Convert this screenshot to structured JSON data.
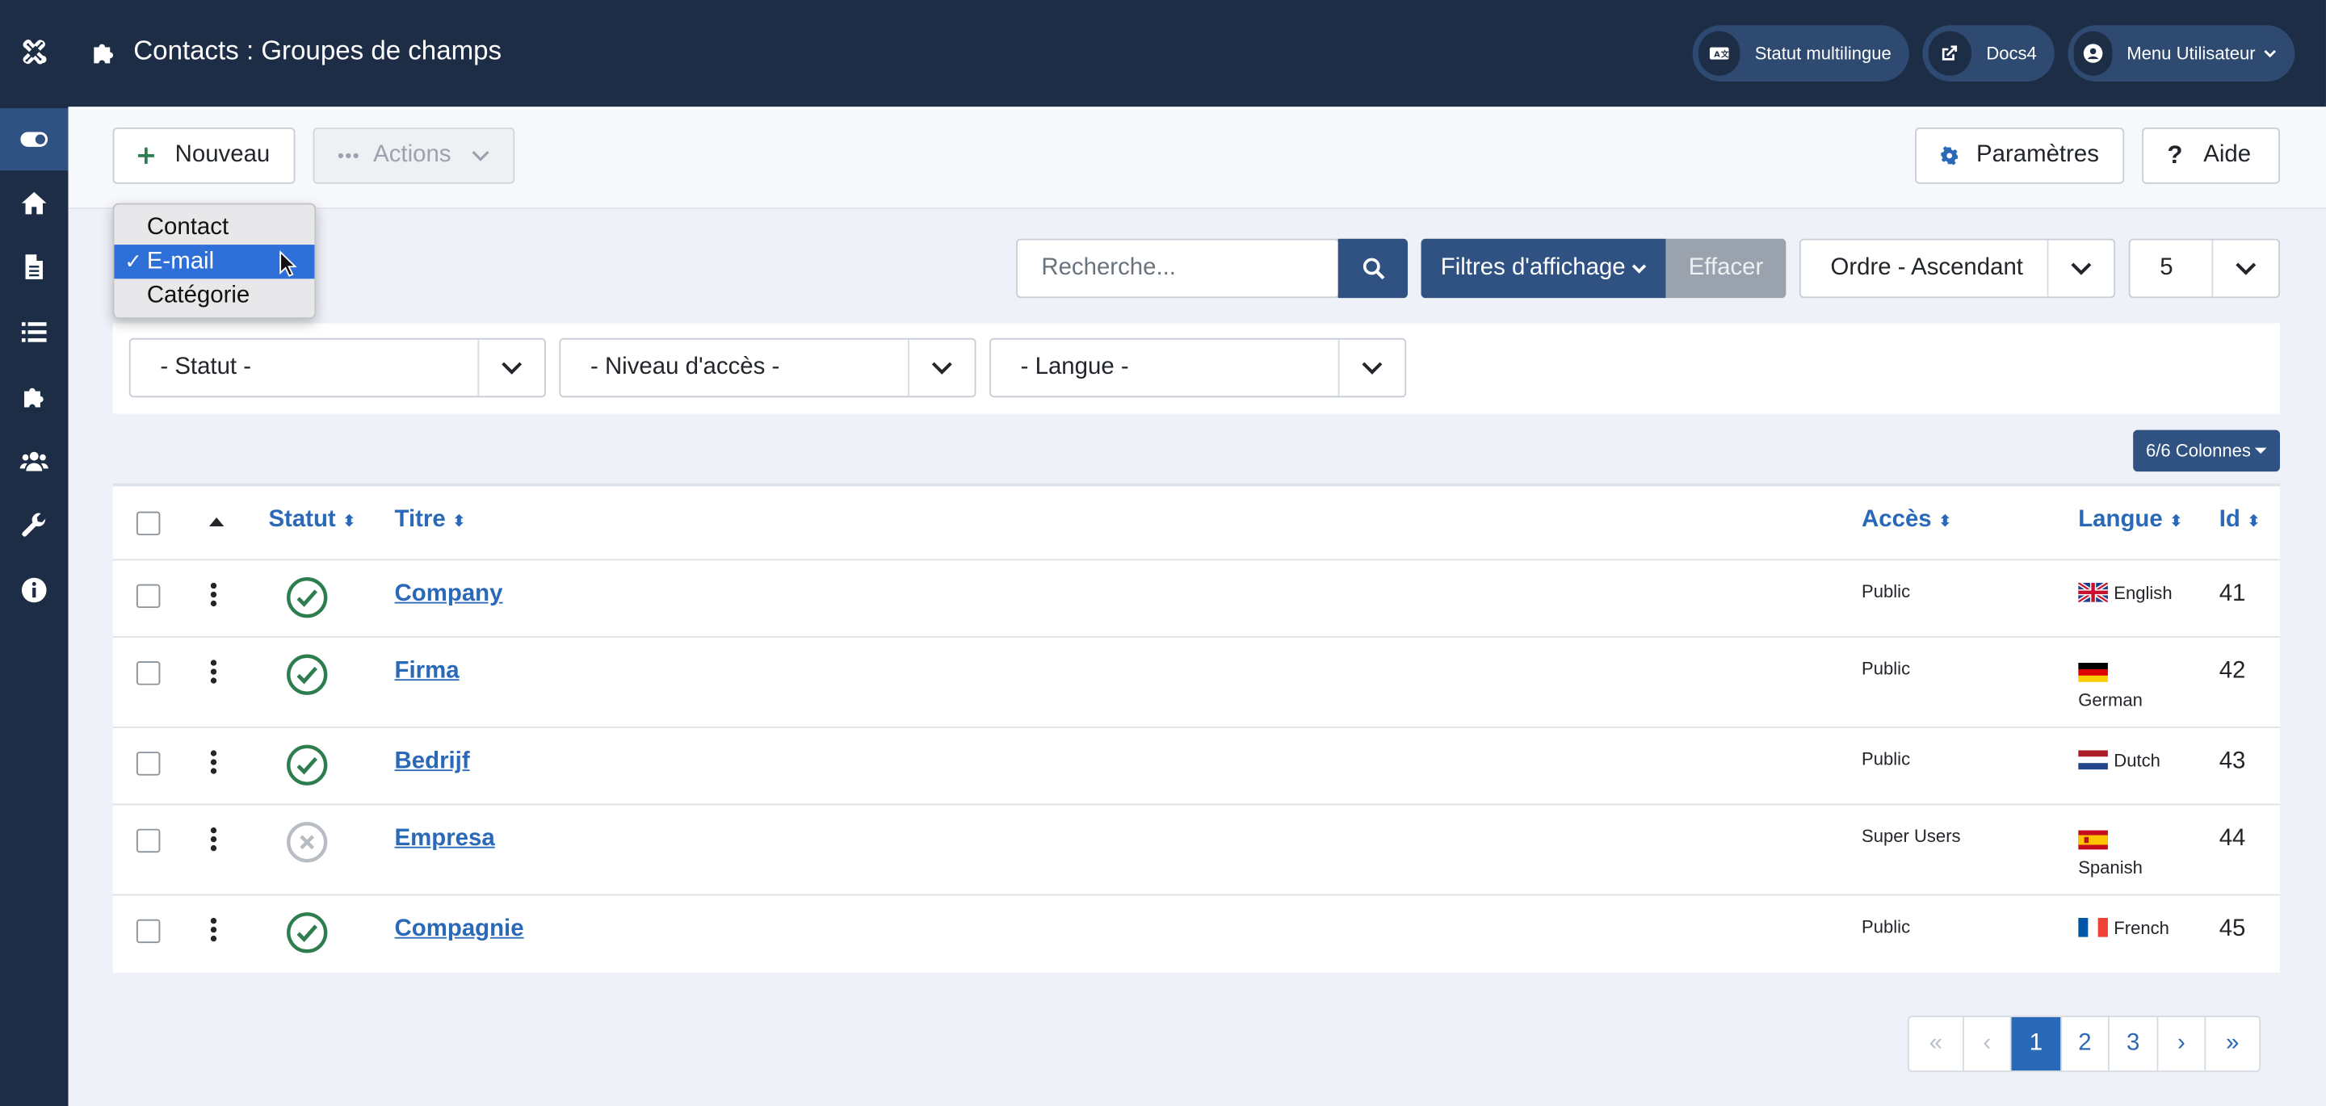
{
  "header": {
    "title": "Contacts : Groupes de champs",
    "multilingual_label": "Statut multilingue",
    "docs_label": "Docs4",
    "user_menu_label": "Menu Utilisateur"
  },
  "sidebar": {
    "items": [
      "toggle-menu-icon",
      "home-icon",
      "file-icon",
      "list-icon",
      "puzzle-icon",
      "users-icon",
      "wrench-icon",
      "info-icon"
    ]
  },
  "toolbar": {
    "new_label": "Nouveau",
    "actions_label": "Actions",
    "options_label": "Paramètres",
    "help_label": "Aide"
  },
  "context_select": {
    "options": [
      "Contact",
      "E-mail",
      "Catégorie"
    ],
    "selected": "E-mail"
  },
  "search": {
    "placeholder": "Recherche...",
    "filter_label": "Filtres d'affichage",
    "clear_label": "Effacer",
    "ordering_value": "Ordre - Ascendant",
    "limit_value": "5"
  },
  "filters": {
    "status": "- Statut -",
    "access": "- Niveau d'accès -",
    "language": "- Langue -"
  },
  "columns_button": "6/6 Colonnes",
  "table": {
    "headers": {
      "status": "Statut",
      "title": "Titre",
      "access": "Accès",
      "language": "Langue",
      "id": "Id"
    },
    "rows": [
      {
        "title": "Company",
        "published": true,
        "access": "Public",
        "language": "English",
        "flag": "gb",
        "id": "41"
      },
      {
        "title": "Firma",
        "published": true,
        "access": "Public",
        "language": "German",
        "flag": "de",
        "id": "42"
      },
      {
        "title": "Bedrijf",
        "published": true,
        "access": "Public",
        "language": "Dutch",
        "flag": "nl",
        "id": "43"
      },
      {
        "title": "Empresa",
        "published": false,
        "access": "Super Users",
        "language": "Spanish",
        "flag": "es",
        "id": "44"
      },
      {
        "title": "Compagnie",
        "published": true,
        "access": "Public",
        "language": "French",
        "flag": "fr",
        "id": "45"
      }
    ]
  },
  "pagination": {
    "pages": [
      "1",
      "2",
      "3"
    ],
    "current": "1"
  },
  "colors": {
    "sidebar_bg": "#1d2d46",
    "accent": "#2a69b8",
    "published": "#2e7d4f",
    "unpublished": "#b8bdc4"
  }
}
